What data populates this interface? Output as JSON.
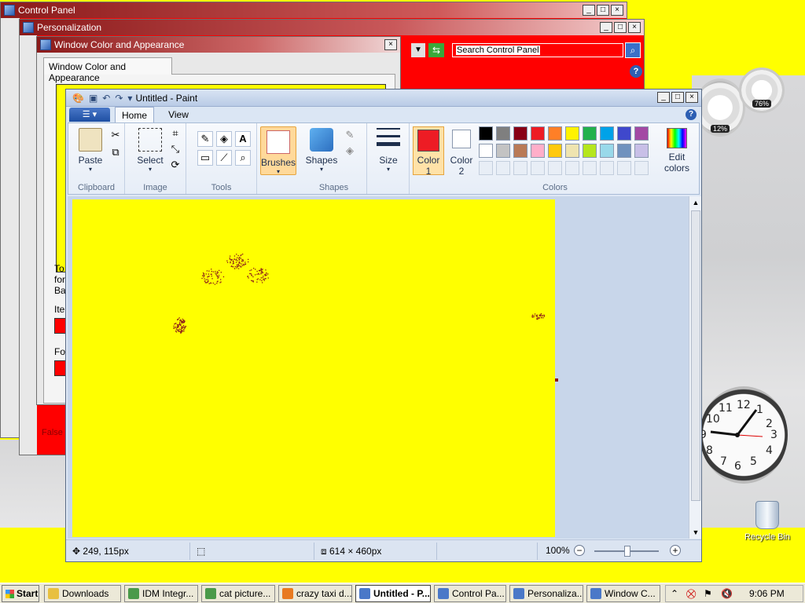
{
  "windows": {
    "control_panel": {
      "title": "Control Panel"
    },
    "personalization": {
      "title": "Personalization",
      "search_placeholder": "Search Control Panel",
      "fragment_text": "False c"
    },
    "window_color": {
      "title": "Window Color and Appearance",
      "tab": "Window Color and Appearance",
      "text_lines": [
        "To",
        "for",
        "Ba",
        "Ite",
        "Fo"
      ]
    },
    "paint": {
      "title": "Untitled - Paint",
      "tabs": [
        "Home",
        "View"
      ],
      "groups": {
        "clipboard": {
          "label": "Clipboard",
          "paste": "Paste"
        },
        "image": {
          "label": "Image",
          "select": "Select"
        },
        "tools": {
          "label": "Tools"
        },
        "brushes": {
          "label": "Brushes"
        },
        "shapes": {
          "label": "Shapes",
          "button": "Shapes"
        },
        "size": {
          "label": "Size"
        },
        "colors": {
          "label": "Colors",
          "color1": "Color\n1",
          "color1_line1": "Color",
          "color1_line2": "1",
          "color2_line1": "Color",
          "color2_line2": "2",
          "edit_line1": "Edit",
          "edit_line2": "colors",
          "active_color": "#ed1c24",
          "palette_row1": [
            "#000000",
            "#7f7f7f",
            "#880015",
            "#ed1c24",
            "#ff7f27",
            "#fff200",
            "#22b14c",
            "#00a2e8",
            "#3f48cc",
            "#a349a4"
          ],
          "palette_row2": [
            "#ffffff",
            "#c3c3c3",
            "#b97a57",
            "#ffaec9",
            "#ffc90e",
            "#efe4b0",
            "#b5e61d",
            "#99d9ea",
            "#7092be",
            "#c8bfe7"
          ]
        }
      },
      "canvas_color": "#ffff00",
      "status": {
        "cursor_pos": "249, 115px",
        "image_size": "614 × 460px",
        "zoom": "100%"
      }
    }
  },
  "gadgets": {
    "cpu_label": "12%",
    "mem_label": "76%",
    "clock_numbers": [
      "12",
      "1",
      "2",
      "3",
      "4",
      "5",
      "6",
      "7",
      "8",
      "9",
      "10",
      "11"
    ]
  },
  "desktop": {
    "recycle_bin": "Recycle Bin"
  },
  "taskbar": {
    "start": "Start",
    "items": [
      {
        "label": "Downloads",
        "icon_color": "#e8c040"
      },
      {
        "label": "IDM Integr...",
        "icon_color": "#4a9a4a"
      },
      {
        "label": "cat picture...",
        "icon_color": "#4a9a4a"
      },
      {
        "label": "crazy taxi d...",
        "icon_color": "#e87a20"
      },
      {
        "label": "Untitled - P...",
        "icon_color": "#4a78c8",
        "active": true
      },
      {
        "label": "Control Pa...",
        "icon_color": "#4a78c8"
      },
      {
        "label": "Personaliza...",
        "icon_color": "#4a78c8"
      },
      {
        "label": "Window C...",
        "icon_color": "#4a78c8"
      }
    ],
    "clock": "9:06 PM"
  }
}
